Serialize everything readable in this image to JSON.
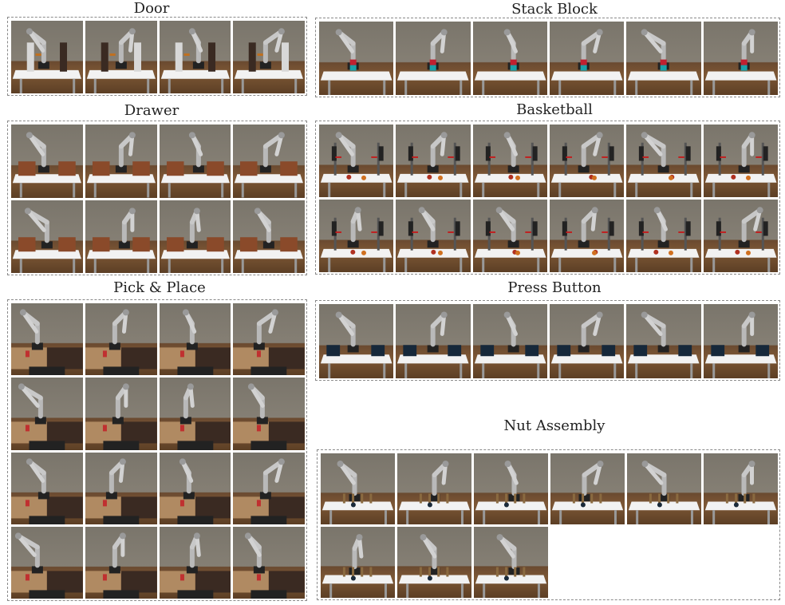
{
  "panels": [
    {
      "id": "door",
      "title": "Door",
      "cols": 4,
      "rows": 1,
      "scene": "door"
    },
    {
      "id": "stack-block",
      "title": "Stack Block",
      "cols": 6,
      "rows": 1,
      "scene": "stack"
    },
    {
      "id": "drawer",
      "title": "Drawer",
      "cols": 4,
      "rows": 2,
      "scene": "drawer"
    },
    {
      "id": "basketball",
      "title": "Basketball",
      "cols": 6,
      "rows": 2,
      "scene": "basket"
    },
    {
      "id": "pick-place",
      "title": "Pick & Place",
      "cols": 4,
      "rows": 4,
      "scene": "pick"
    },
    {
      "id": "press-button",
      "title": "Press Button",
      "cols": 6,
      "rows": 1,
      "scene": "press"
    },
    {
      "id": "nut-assembly",
      "title": "Nut Assembly",
      "cols": 6,
      "rows": 2,
      "count": 9,
      "scene": "nut"
    }
  ]
}
